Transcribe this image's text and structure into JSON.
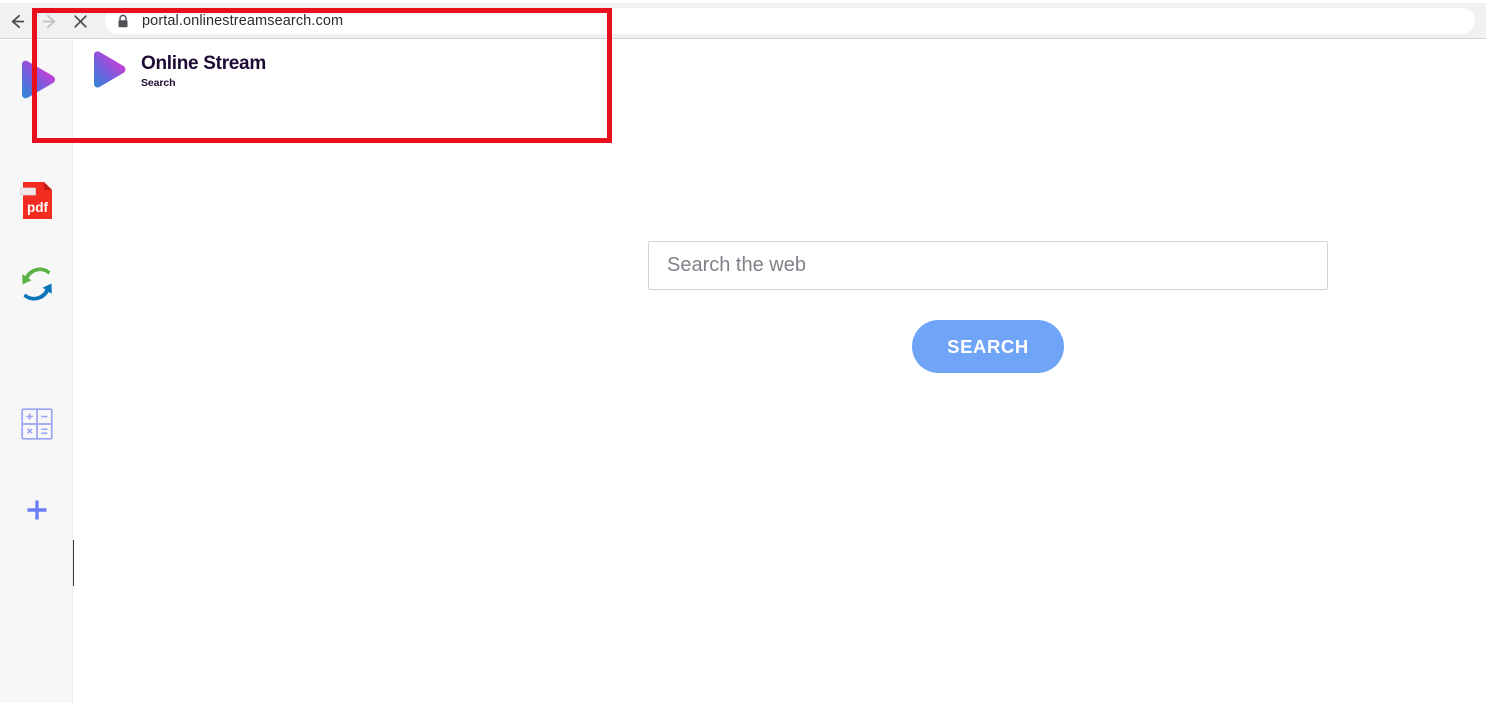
{
  "browser": {
    "back_icon": "back-arrow-icon",
    "forward_icon": "forward-arrow-icon",
    "stop_icon": "stop-close-icon",
    "lock_icon": "lock-icon",
    "url": "portal.onlinestreamsearch.com",
    "toolbar_bg": "#f1f1f2"
  },
  "sidebar": {
    "background": "#f7f7f8",
    "items": [
      {
        "name": "online-stream-logo",
        "icon": "play-triangle-icon"
      },
      {
        "name": "pdf-tool",
        "icon": "pdf-file-icon",
        "label": "pdf"
      },
      {
        "name": "converter-tool",
        "icon": "convert-arrows-icon"
      },
      {
        "name": "calculator-tool",
        "icon": "calculator-grid-icon",
        "keys": [
          "+",
          "−",
          "×",
          "="
        ]
      },
      {
        "name": "add-tool",
        "icon": "plus-icon"
      }
    ],
    "collapse": {
      "icon": "chevron-left-icon",
      "glyph": "‹",
      "color": "#3b3540"
    }
  },
  "site": {
    "brand": {
      "title": "Online Stream",
      "subtitle": "Search",
      "logo_icon": "play-triangle-icon",
      "gradient_from": "#d62bd6",
      "gradient_to": "#2b7bd6"
    },
    "search": {
      "placeholder": "Search the web",
      "value": "",
      "button_label": "SEARCH",
      "button_color": "#6fa4f7"
    }
  },
  "annotation": {
    "shape": "rectangle",
    "color": "#e8101c",
    "target": "url-bar-and-site-header"
  }
}
